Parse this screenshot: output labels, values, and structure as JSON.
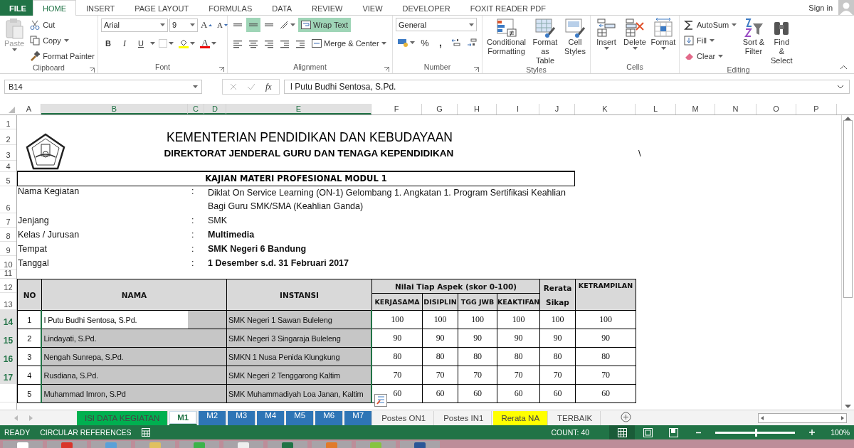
{
  "ribbon_tabs": [
    {
      "label": "FILE",
      "kind": "file",
      "selected": false
    },
    {
      "label": "HOME",
      "kind": "tab",
      "selected": true
    },
    {
      "label": "INSERT",
      "kind": "tab",
      "selected": false
    },
    {
      "label": "PAGE LAYOUT",
      "kind": "tab",
      "selected": false
    },
    {
      "label": "FORMULAS",
      "kind": "tab",
      "selected": false
    },
    {
      "label": "DATA",
      "kind": "tab",
      "selected": false
    },
    {
      "label": "REVIEW",
      "kind": "tab",
      "selected": false
    },
    {
      "label": "VIEW",
      "kind": "tab",
      "selected": false
    },
    {
      "label": "DEVELOPER",
      "kind": "tab",
      "selected": false
    },
    {
      "label": "FOXIT READER PDF",
      "kind": "tab",
      "selected": false
    }
  ],
  "account": {
    "label": "Sign in"
  },
  "clipboard": {
    "label": "Clipboard",
    "paste": "Paste",
    "cut": "Cut",
    "copy": "Copy",
    "format_painter": "Format Painter"
  },
  "font": {
    "label": "Font",
    "name": "Arial",
    "size": "9",
    "grow": "A",
    "shrink": "A",
    "bold": "B",
    "italic": "I",
    "underline": "U",
    "color_letter": "A"
  },
  "alignment": {
    "label": "Alignment",
    "vertical_align": [
      {
        "selected": false
      },
      {
        "selected": true
      },
      {
        "selected": false
      }
    ],
    "wrap_text": {
      "label": "Wrap Text",
      "on": true
    },
    "merge_center": "Merge & Center"
  },
  "number": {
    "label": "Number",
    "format": "General",
    "percent": "%",
    "comma": ","
  },
  "styles": {
    "label": "Styles",
    "buttons": [
      "Conditional Formatting",
      "Format as Table",
      "Cell Styles"
    ]
  },
  "cells": {
    "label": "Cells",
    "buttons": [
      "Insert",
      "Delete",
      "Format"
    ]
  },
  "editing": {
    "label": "Editing",
    "autosum": "AutoSum",
    "fill": "Fill",
    "clear": "Clear",
    "buttons": [
      "Sort & Filter",
      "Find & Select"
    ]
  },
  "formula_bar": {
    "name_box": "B14",
    "function_label": "fx",
    "formula": "I Putu Budhi Sentosa, S.Pd."
  },
  "columns": [
    {
      "label": "A",
      "selected": false
    },
    {
      "label": "B",
      "selected": true
    },
    {
      "label": "C",
      "selected": true
    },
    {
      "label": "D",
      "selected": true
    },
    {
      "label": "E",
      "selected": true
    },
    {
      "label": "F",
      "selected": false
    },
    {
      "label": "G",
      "selected": false
    },
    {
      "label": "H",
      "selected": false
    },
    {
      "label": "I",
      "selected": false
    },
    {
      "label": "J",
      "selected": false
    },
    {
      "label": "K",
      "selected": false
    },
    {
      "label": "L",
      "selected": false
    },
    {
      "label": "M",
      "selected": false
    },
    {
      "label": "N",
      "selected": false
    },
    {
      "label": "O",
      "selected": false
    },
    {
      "label": "P",
      "selected": false
    }
  ],
  "rows": [
    {
      "label": "1",
      "selected": false
    },
    {
      "label": "2",
      "selected": false
    },
    {
      "label": "3",
      "selected": false
    },
    {
      "label": "4",
      "selected": false
    },
    {
      "label": "5",
      "selected": false
    },
    {
      "label": "6",
      "selected": false
    },
    {
      "label": "7",
      "selected": false
    },
    {
      "label": "8",
      "selected": false
    },
    {
      "label": "9",
      "selected": false
    },
    {
      "label": "10",
      "selected": false
    },
    {
      "label": "11",
      "selected": false
    },
    {
      "label": "12",
      "selected": false
    },
    {
      "label": "13",
      "selected": false
    },
    {
      "label": "14",
      "selected": true
    },
    {
      "label": "15",
      "selected": true
    },
    {
      "label": "16",
      "selected": true
    },
    {
      "label": "17",
      "selected": true
    }
  ],
  "sheet": {
    "title": "KEMENTERIAN PENDIDIKAN DAN KEBUDAYAAN",
    "subtitle": "DIREKTORAT JENDERAL GURU DAN TENAGA KEPENDIDIKAN",
    "stray_mark": "\\",
    "module_title": "KAJIAN MATERI PROFESIONAL MODUL 1",
    "info": [
      {
        "label": "Nama Kegiatan",
        "separator": ":",
        "value": "Diklat On Service Learning (ON-1) Gelombang 1. Angkatan 1. Program Sertifikasi Keahlian Bagi Guru SMK/SMA (Keahlian Ganda)",
        "bold": false
      },
      {
        "label": "Jenjang",
        "separator": ":",
        "value": "SMK",
        "bold": false
      },
      {
        "label": "Kelas / Jurusan",
        "separator": ":",
        "value": "Multimedia",
        "bold": true
      },
      {
        "label": "Tempat",
        "separator": ":",
        "value": "SMK Negeri 6 Bandung",
        "bold": true
      },
      {
        "label": "Tanggal",
        "separator": ":",
        "value": "1 Desember  s.d. 31 Februari 2017",
        "bold": true
      }
    ]
  },
  "table": {
    "headers": {
      "no": "NO",
      "nama": "NAMA",
      "instansi": "INSTANSI",
      "group": "Nilai Tiap Aspek (skor 0-100)",
      "aspects": [
        "KERJASAMA",
        "DISIPLIN",
        "TGG JWB",
        "KEAKTIFAN"
      ],
      "average": "Rerata Sikap",
      "skill": "KETRAMPILAN"
    },
    "rows": [
      {
        "no": "1",
        "nama": "I Putu Budhi Sentosa, S.Pd.",
        "instansi": "SMK Negeri 1 Sawan Buleleng",
        "scores": [
          "100",
          "100",
          "100",
          "100",
          "100",
          "100"
        ],
        "selected": true,
        "active": true
      },
      {
        "no": "2",
        "nama": "Lindayati, S.Pd.",
        "instansi": "SMK Negeri 3 Singaraja Buleleng",
        "scores": [
          "90",
          "90",
          "90",
          "90",
          "90",
          "90"
        ],
        "selected": true,
        "active": false
      },
      {
        "no": "3",
        "nama": "Nengah Sunrepa, S.Pd.",
        "instansi": "SMKN 1 Nusa Penida Klungkung",
        "scores": [
          "80",
          "80",
          "80",
          "80",
          "80",
          "80"
        ],
        "selected": true,
        "active": false
      },
      {
        "no": "4",
        "nama": "Rusdiana, S.Pd.",
        "instansi": "SMK Negeri 2 Tenggarong Kaltim",
        "scores": [
          "70",
          "70",
          "70",
          "70",
          "70",
          "70"
        ],
        "selected": true,
        "active": false
      },
      {
        "no": "5",
        "nama": "Muhammad Imron, S.Pd",
        "instansi": "SMK Muhammadiyah Loa Janan, Kaltim",
        "scores": [
          "60",
          "60",
          "60",
          "60",
          "60",
          "60"
        ],
        "selected": true,
        "active": false
      }
    ]
  },
  "sheet_tabs": [
    {
      "label": "ISI DATA KEGIATAN",
      "color": "#00b050",
      "selected": false
    },
    {
      "label": "M1",
      "selected": true
    },
    {
      "label": "M2",
      "color": "#2e75b6",
      "selected": false
    },
    {
      "label": "M3",
      "color": "#2e75b6",
      "selected": false
    },
    {
      "label": "M4",
      "color": "#2e75b6",
      "selected": false
    },
    {
      "label": "M5",
      "color": "#2e75b6",
      "selected": false
    },
    {
      "label": "M6",
      "color": "#2e75b6",
      "selected": false
    },
    {
      "label": "M7",
      "color": "#2e75b6",
      "selected": false
    },
    {
      "label": "Postes ON1",
      "selected": false
    },
    {
      "label": "Postes IN1",
      "selected": false
    },
    {
      "label": "Rerata NA",
      "color": "#ffff00",
      "selected": false
    },
    {
      "label": "TERBAIK",
      "selected": false
    }
  ],
  "status_bar": {
    "mode": "READY",
    "message": "CIRCULAR REFERENCES",
    "count": "COUNT: 40",
    "views": [
      {
        "selected": true
      },
      {
        "selected": false
      },
      {
        "selected": false
      }
    ],
    "zoom_slider": {
      "level": 0.5
    },
    "zoom": "100%"
  }
}
